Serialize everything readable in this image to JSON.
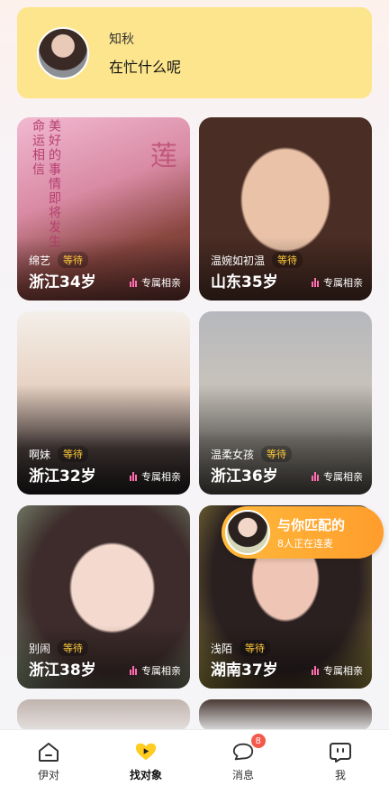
{
  "banner": {
    "name": "知秋",
    "message": "在忙什么呢"
  },
  "cards": [
    {
      "nick": "绵艺",
      "status": "等待",
      "location": "浙江34岁",
      "tag": "专属相亲"
    },
    {
      "nick": "温婉如初温",
      "status": "等待",
      "location": "山东35岁",
      "tag": "专属相亲"
    },
    {
      "nick": "啊妹",
      "status": "等待",
      "location": "浙江32岁",
      "tag": "专属相亲"
    },
    {
      "nick": "温柔女孩",
      "status": "等待",
      "location": "浙江36岁",
      "tag": "专属相亲"
    },
    {
      "nick": "别闹",
      "status": "等待",
      "location": "浙江38岁",
      "tag": "专属相亲"
    },
    {
      "nick": "浅陌",
      "status": "等待",
      "location": "湖南37岁",
      "tag": "专属相亲"
    }
  ],
  "card1_deco": {
    "vertical_text": "美好的事情即将发生 命运相信",
    "lotus": "莲"
  },
  "match": {
    "title": "与你匹配的",
    "subtitle": "8人正在连麦"
  },
  "tabs": [
    {
      "label": "伊对",
      "icon": "home-icon"
    },
    {
      "label": "找对象",
      "icon": "heart-play-icon"
    },
    {
      "label": "消息",
      "icon": "chat-bubble-icon",
      "badge": "8"
    },
    {
      "label": "我",
      "icon": "profile-face-icon"
    }
  ]
}
